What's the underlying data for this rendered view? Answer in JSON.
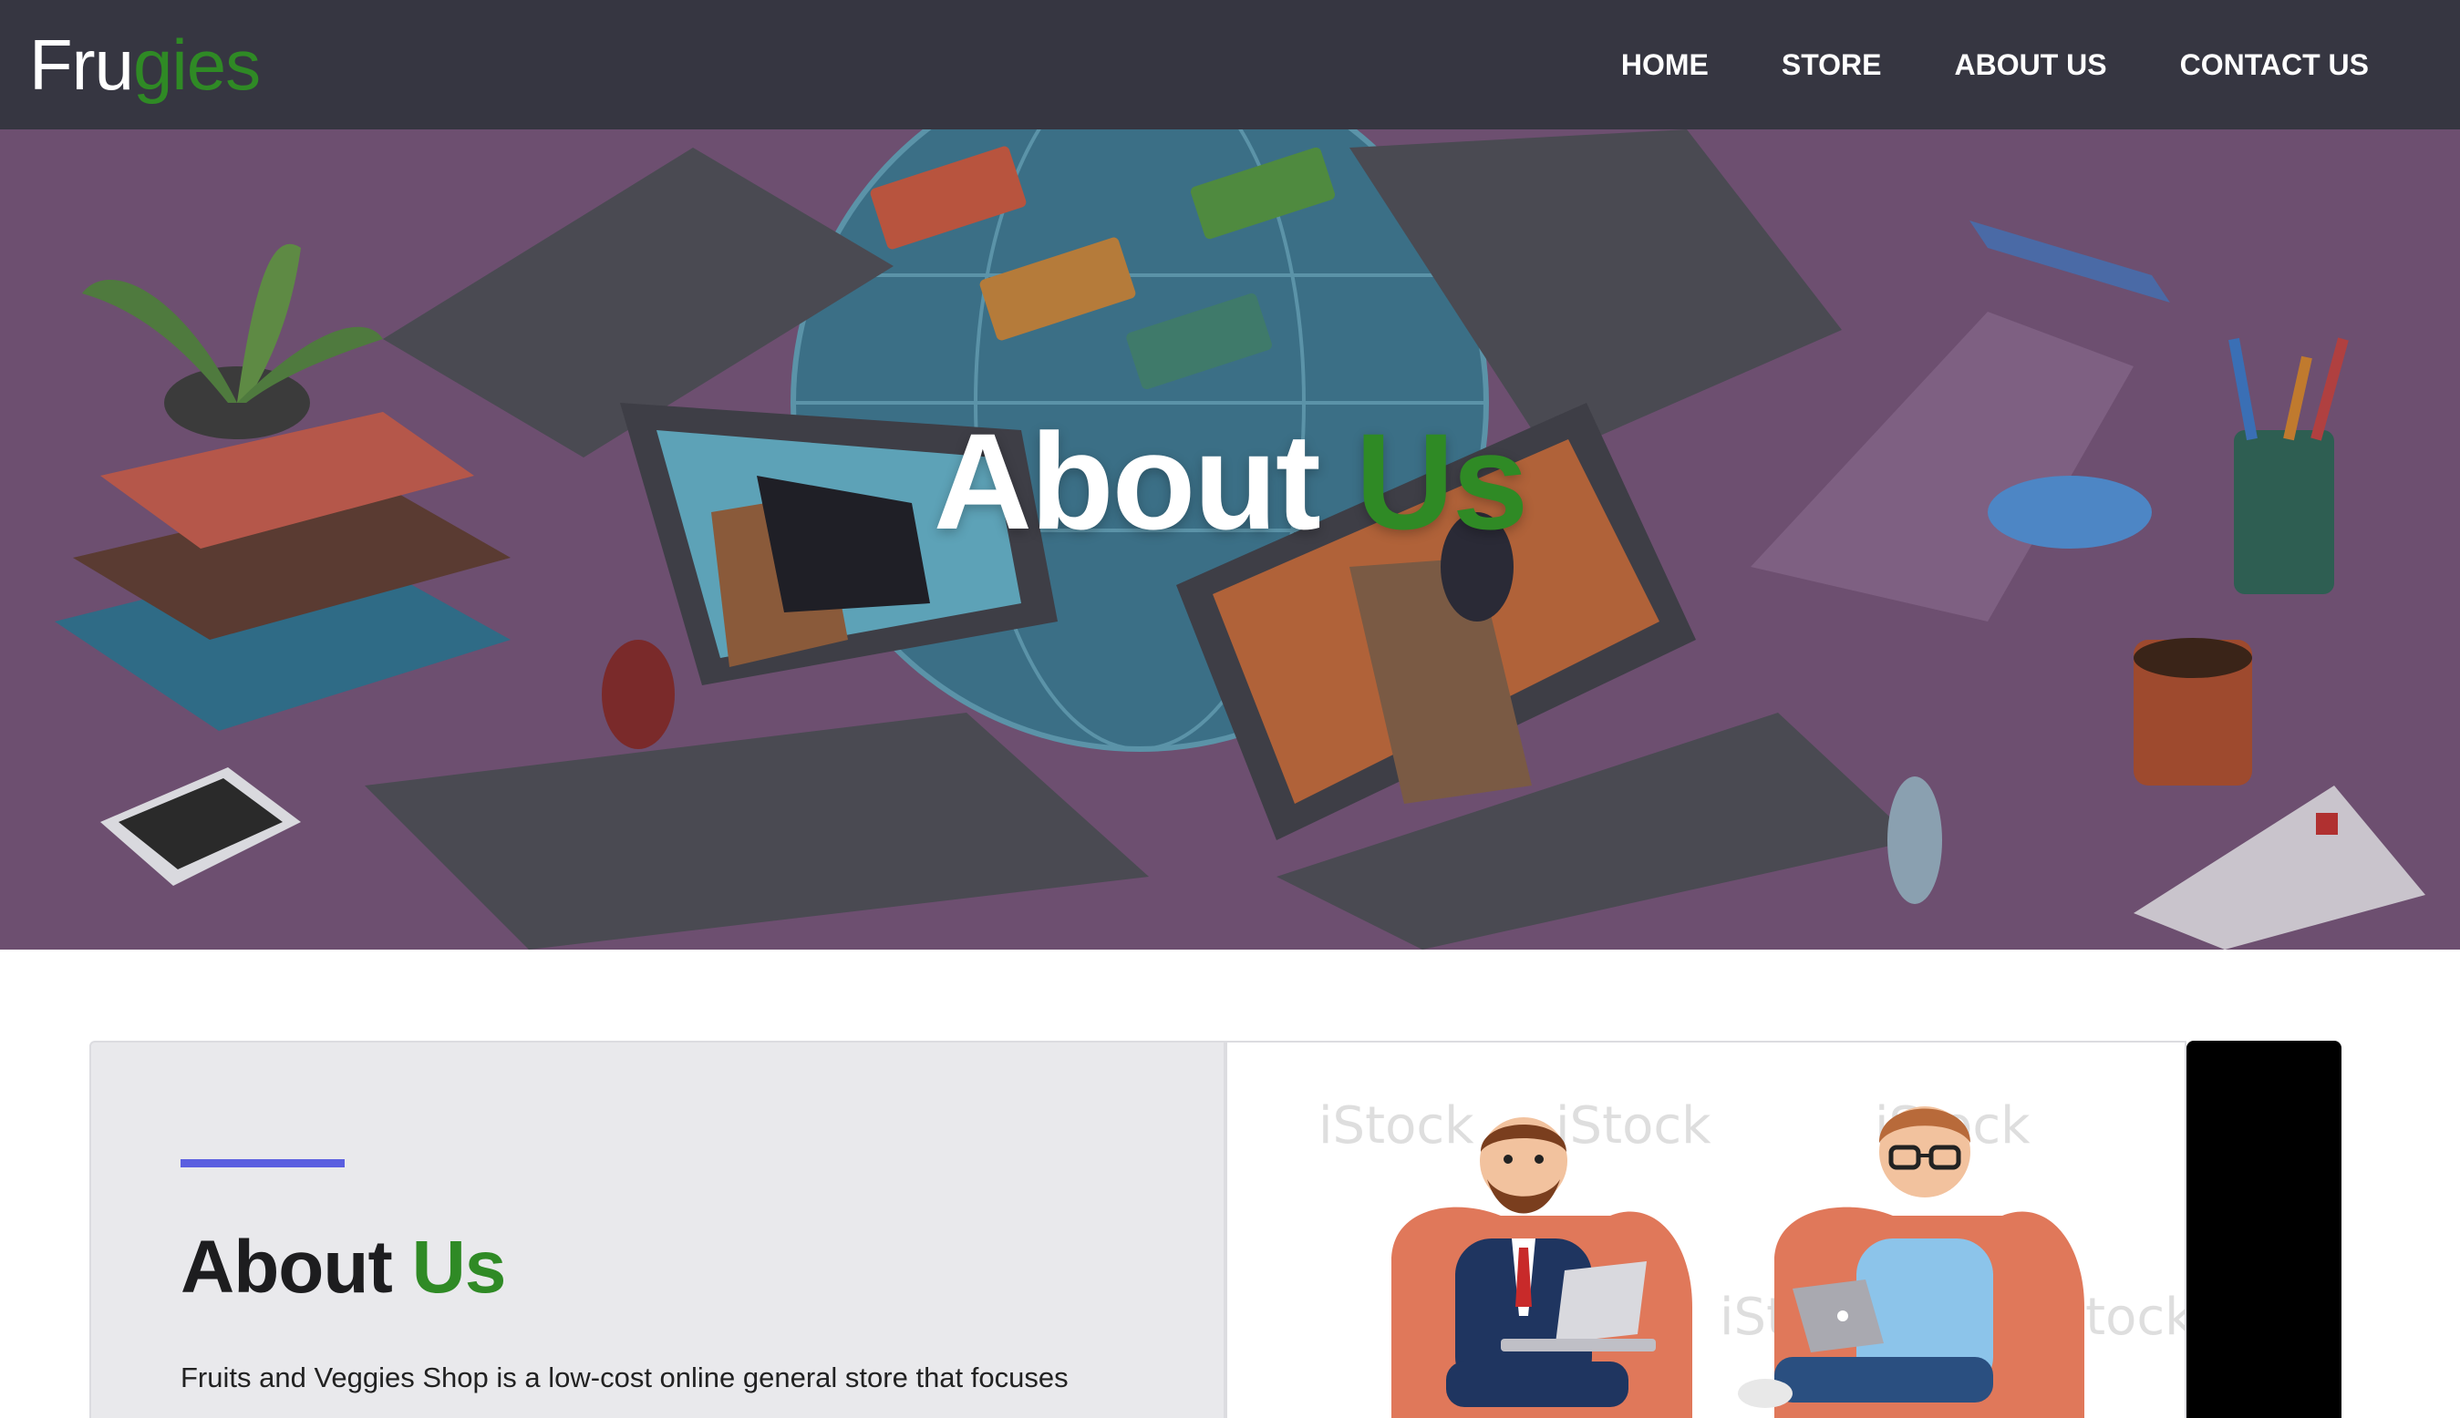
{
  "brand": {
    "name_part1": "Fru",
    "name_part2": "gies"
  },
  "nav": {
    "items": [
      {
        "label": "HOME"
      },
      {
        "label": "STORE"
      },
      {
        "label": "ABOUT US"
      },
      {
        "label": "CONTACT US"
      }
    ]
  },
  "hero": {
    "title_part1": "About ",
    "title_part2": "Us"
  },
  "about": {
    "heading_part1": "About ",
    "heading_part2": "Us",
    "text": "Fruits and Veggies Shop is a low-cost online general store that focuses"
  },
  "image_card": {
    "watermark": "iStock"
  },
  "colors": {
    "nav_bg": "#363641",
    "brand_accent": "#2f8a25",
    "divider": "#5a5ee0",
    "card_bg": "#e9e9ec"
  }
}
